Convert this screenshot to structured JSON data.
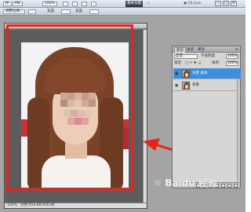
{
  "app": {
    "essentials_label": "基本功能",
    "cs_live": "CS Live",
    "window_controls": [
      "–",
      "□",
      "✕"
    ]
  },
  "topbar": {
    "items": [
      "Br",
      "Mb",
      "100%"
    ]
  },
  "options": {
    "items": [
      "调整边缘...",
      "宽度:",
      "高度:"
    ]
  },
  "document": {
    "tab_label": "",
    "status_zoom": "100%",
    "status_text": "文档:458.8K/458.8K"
  },
  "layers_panel": {
    "tabs": [
      "图层",
      "通道",
      "路径"
    ],
    "blend_mode": "正常",
    "opacity_label": "不透明度:",
    "opacity_value": "100%",
    "lock_label": "锁定:",
    "fill_label": "填充:",
    "fill_value": "100%",
    "layers": [
      {
        "name": "背景 副本",
        "selected": true
      },
      {
        "name": "背景",
        "selected": false
      }
    ]
  },
  "annotations": {
    "frame_color": "#e8231c",
    "arrow_color": "#e8231c"
  },
  "watermark": {
    "text": "Baidu 经验"
  }
}
